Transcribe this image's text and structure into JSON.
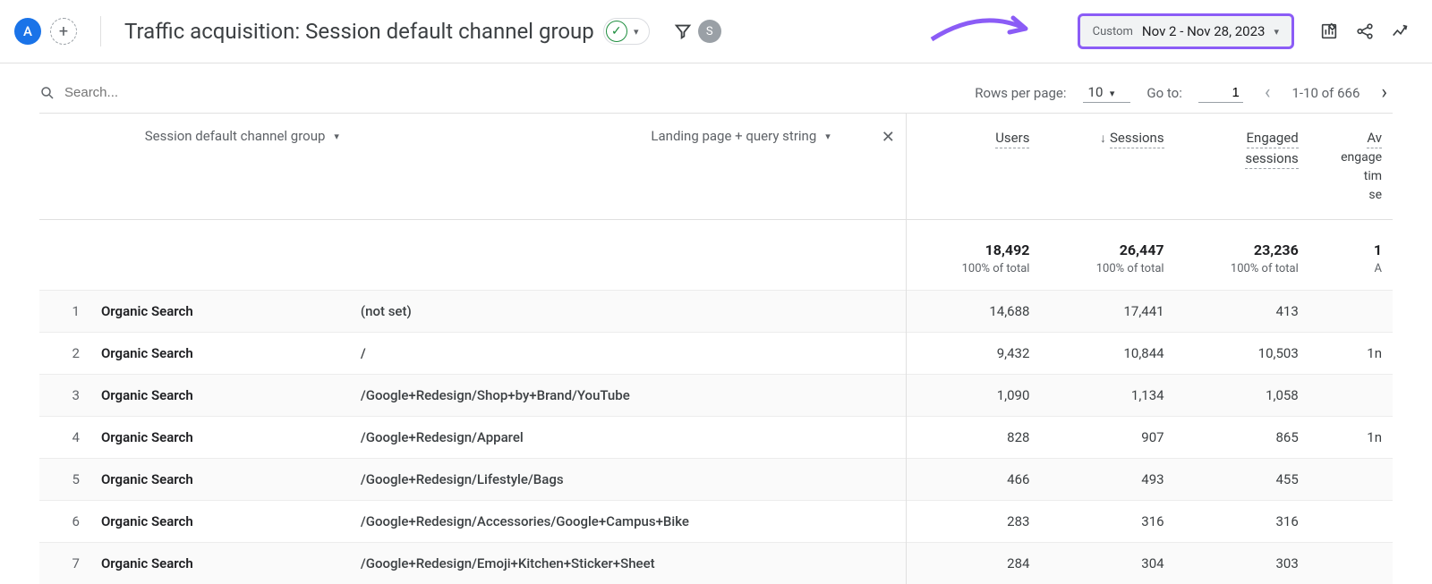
{
  "header": {
    "avatar_letter": "A",
    "title": "Traffic acquisition: Session default channel group",
    "s_letter": "S",
    "date_label": "Custom",
    "date_range": "Nov 2 - Nov 28, 2023"
  },
  "table_controls": {
    "search_placeholder": "Search...",
    "rows_per_page_label": "Rows per page:",
    "rows_per_page_value": "10",
    "goto_label": "Go to:",
    "goto_value": "1",
    "range_text": "1-10 of 666"
  },
  "dimensions": {
    "primary": "Session default channel group",
    "secondary": "Landing page + query string"
  },
  "metrics": {
    "users_label": "Users",
    "sessions_label": "Sessions",
    "engaged_label_l1": "Engaged",
    "engaged_label_l2": "sessions",
    "avg_l1": "Av",
    "avg_l2": "engage",
    "avg_l3": "tim",
    "avg_l4": "se"
  },
  "totals": {
    "users": "18,492",
    "sessions": "26,447",
    "engaged": "23,236",
    "avg_partial": "1",
    "pct_label": "100% of total"
  },
  "rows": [
    {
      "idx": "1",
      "channel": "Organic Search",
      "landing": "(not set)",
      "users": "14,688",
      "sessions": "17,441",
      "engaged": "413",
      "avg": ""
    },
    {
      "idx": "2",
      "channel": "Organic Search",
      "landing": "/",
      "users": "9,432",
      "sessions": "10,844",
      "engaged": "10,503",
      "avg": "1n"
    },
    {
      "idx": "3",
      "channel": "Organic Search",
      "landing": "/Google+Redesign/Shop+by+Brand/YouTube",
      "users": "1,090",
      "sessions": "1,134",
      "engaged": "1,058",
      "avg": ""
    },
    {
      "idx": "4",
      "channel": "Organic Search",
      "landing": "/Google+Redesign/Apparel",
      "users": "828",
      "sessions": "907",
      "engaged": "865",
      "avg": "1n"
    },
    {
      "idx": "5",
      "channel": "Organic Search",
      "landing": "/Google+Redesign/Lifestyle/Bags",
      "users": "466",
      "sessions": "493",
      "engaged": "455",
      "avg": ""
    },
    {
      "idx": "6",
      "channel": "Organic Search",
      "landing": "/Google+Redesign/Accessories/Google+Campus+Bike",
      "users": "283",
      "sessions": "316",
      "engaged": "316",
      "avg": ""
    },
    {
      "idx": "7",
      "channel": "Organic Search",
      "landing": "/Google+Redesign/Emoji+Kitchen+Sticker+Sheet",
      "users": "284",
      "sessions": "304",
      "engaged": "303",
      "avg": ""
    }
  ]
}
